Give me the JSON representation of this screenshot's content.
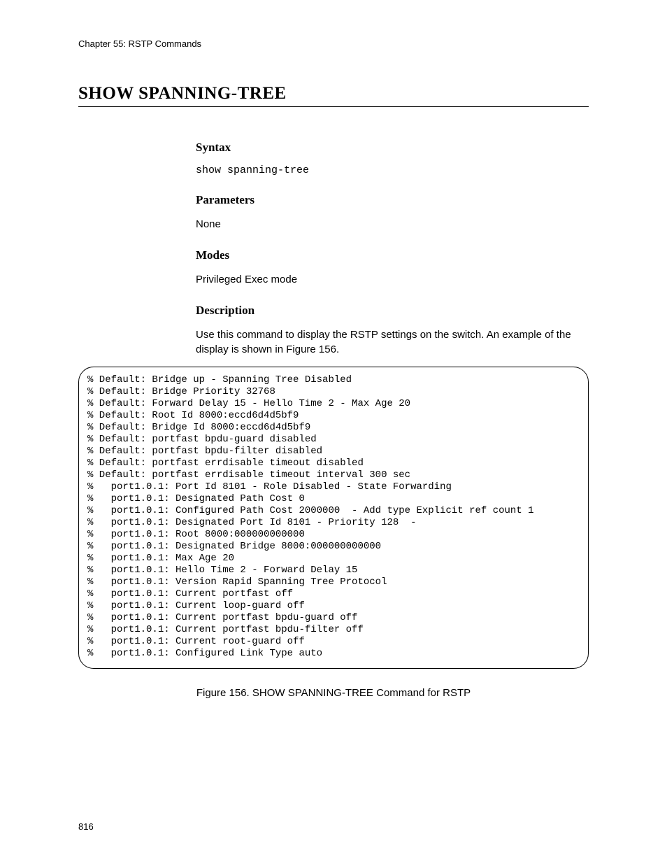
{
  "chapter_header": "Chapter 55: RSTP Commands",
  "title": "SHOW SPANNING-TREE",
  "sections": {
    "syntax": {
      "heading": "Syntax",
      "body": "show spanning-tree"
    },
    "parameters": {
      "heading": "Parameters",
      "body": "None"
    },
    "modes": {
      "heading": "Modes",
      "body": "Privileged Exec mode"
    },
    "description": {
      "heading": "Description",
      "body": "Use this command to display the RSTP settings on the switch. An example of the display is shown in Figure 156."
    }
  },
  "terminal_output": "% Default: Bridge up - Spanning Tree Disabled\n% Default: Bridge Priority 32768\n% Default: Forward Delay 15 - Hello Time 2 - Max Age 20\n% Default: Root Id 8000:eccd6d4d5bf9\n% Default: Bridge Id 8000:eccd6d4d5bf9\n% Default: portfast bpdu-guard disabled\n% Default: portfast bpdu-filter disabled\n% Default: portfast errdisable timeout disabled\n% Default: portfast errdisable timeout interval 300 sec\n%   port1.0.1: Port Id 8101 - Role Disabled - State Forwarding\n%   port1.0.1: Designated Path Cost 0\n%   port1.0.1: Configured Path Cost 2000000  - Add type Explicit ref count 1\n%   port1.0.1: Designated Port Id 8101 - Priority 128  -\n%   port1.0.1: Root 8000:000000000000\n%   port1.0.1: Designated Bridge 8000:000000000000\n%   port1.0.1: Max Age 20\n%   port1.0.1: Hello Time 2 - Forward Delay 15\n%   port1.0.1: Version Rapid Spanning Tree Protocol\n%   port1.0.1: Current portfast off\n%   port1.0.1: Current loop-guard off\n%   port1.0.1: Current portfast bpdu-guard off\n%   port1.0.1: Current portfast bpdu-filter off\n%   port1.0.1: Current root-guard off\n%   port1.0.1: Configured Link Type auto",
  "figure_caption": "Figure 156. SHOW SPANNING-TREE Command for RSTP",
  "page_number": "816"
}
